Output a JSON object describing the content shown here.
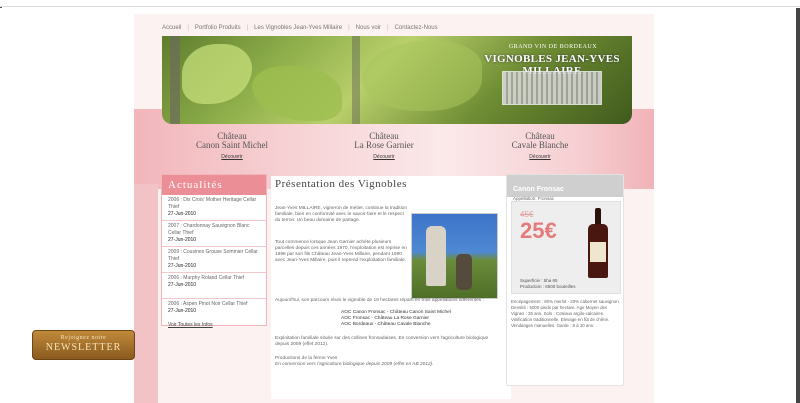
{
  "nav": {
    "items": [
      "Accueil",
      "Portfolio Produits",
      "Les Vignobles Jean-Yves Millaire",
      "Nous voir",
      "Contactez-Nous"
    ]
  },
  "banner": {
    "subtitle": "GRAND VIN DE BORDEAUX",
    "title": "VIGNOBLES JEAN-YVES MILLAIRE"
  },
  "chateaux": [
    {
      "line1": "Château",
      "line2": "Canon Saint Michel",
      "link": "Découvrir"
    },
    {
      "line1": "Château",
      "line2": "La Rose Garnier",
      "link": "Découvrir"
    },
    {
      "line1": "Château",
      "line2": "Cavale Blanche",
      "link": "Découvrir"
    }
  ],
  "sidebar": {
    "title": "Actualités",
    "news": [
      {
        "text": "2006 : Dix Crois' Mother Heritage Cellar Thief",
        "date": "27-Jun-2010"
      },
      {
        "text": "2007 : Chardonnay Sauvignon Blanc Cellar Thief",
        "date": "27-Jun-2010"
      },
      {
        "text": "2009 : Cousines Grouse Sommier Cellar Thief",
        "date": "27-Jun-2010"
      },
      {
        "text": "2006 : Murphy Roland Cellar Thief",
        "date": "27-Jun-2010"
      },
      {
        "text": "2006 : Aspen Pinot Noir Cellar Thief",
        "date": "27-Jun-2010"
      }
    ],
    "all_news": "Voir Toutes les Infos"
  },
  "newsletter": {
    "line1": "Rejoignez notre",
    "line2": "NEWSLETTER"
  },
  "main": {
    "title": "Présentation des Vignobles",
    "para1": "Jean-Yves MILLAIRE, vigneron de métier, continue la tradition familiale, bien en conformité avec le savoir-faire et le respect du terroir. Un beau domaine de partage.",
    "para2": "Tout commence lorsque Jean Garnier achète plusieurs parcelles depuis ces années 1970, l'exploitation est reprise en 1998 par son fils Château Jean-Yves Millaire, pendant 1990 avec Jean-Yves Millaire, puis il reprend l'exploitation familiale.",
    "para3": "Aujourd'hui, son parcours réuni le vignoble de 19 hectares réparti en trois appellations différentes :",
    "list": [
      "AOC Canon Fronsac - Château Canon Saint Michel",
      "AOC Fronsac - Château La Rose Garnier",
      "AOC Bordeaux - Château Cavale Blanche"
    ],
    "para4": "Exploitation familiale située sur des collines fronsadaises. En conversion vers l'agriculture biologique depuis 2009 (effet 2012).",
    "para5": "Productions de la ferme Yves",
    "para6": "En conversion vers l'agriculture biologique depuis 2009 (effet en AB 2012)."
  },
  "product": {
    "name": "Canon Fronsac",
    "appellation": "Appellation: Fronsac",
    "old_price": "45€",
    "price": "25€",
    "info1": "Superficie : 5ha 65",
    "info2": "Production : 6500 bouteilles",
    "desc": "Encépagement : 80% merlot - 20% cabernet sauvignon. Densité : 5000 pieds par hectare. Age Moyen des Vignes : 35 ans. Sols : Coteaux argilo-calcaires. Vinification traditionnelle. Elevage en fût de chêne. Vendanges manuelles. Garde : 8 à 10 ans."
  }
}
